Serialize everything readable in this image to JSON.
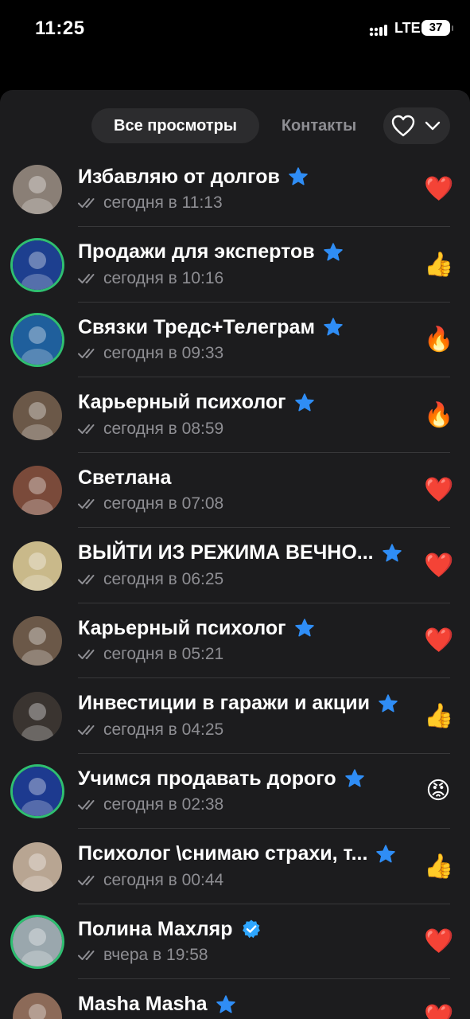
{
  "status": {
    "time": "11:25",
    "network": "LTE",
    "battery": "37"
  },
  "tabs": [
    {
      "label": "Все просмотры",
      "active": true
    },
    {
      "label": "Контакты",
      "active": false
    }
  ],
  "reaction_filter": {
    "icon": "heart-outline-icon",
    "chevron": "chevron-down-icon"
  },
  "viewers": [
    {
      "name": "Избавляю от долгов",
      "badge": "premium-star",
      "time": "сегодня в 11:13",
      "reaction": "❤️",
      "avatar_color": "#8a7f76"
    },
    {
      "name": "Продажи для экспертов",
      "badge": "premium-star",
      "time": "сегодня в 10:16",
      "reaction": "👍",
      "avatar_color": "#1d3f8f"
    },
    {
      "name": "Связки Тредс+Телеграм",
      "badge": "premium-star",
      "time": "сегодня в 09:33",
      "reaction": "🔥",
      "avatar_color": "#1f5f9c"
    },
    {
      "name": "Карьерный психолог",
      "badge": "premium-star",
      "time": "сегодня в 08:59",
      "reaction": "🔥",
      "avatar_color": "#6b5848"
    },
    {
      "name": "Светлана",
      "badge": "",
      "time": "сегодня в 07:08",
      "reaction": "❤️",
      "avatar_color": "#7a4a3a"
    },
    {
      "name": "ВЫЙТИ ИЗ РЕЖИМА ВЕЧНО...",
      "badge": "premium-star",
      "time": "сегодня в 06:25",
      "reaction": "❤️",
      "avatar_color": "#c9b98a"
    },
    {
      "name": "Карьерный психолог",
      "badge": "premium-star",
      "time": "сегодня в 05:21",
      "reaction": "❤️",
      "avatar_color": "#6b5848"
    },
    {
      "name": "Инвестиции в гаражи и акции",
      "badge": "premium-star",
      "time": "сегодня в 04:25",
      "reaction": "👍",
      "avatar_color": "#3a3430"
    },
    {
      "name": "Учимся продавать дорого",
      "badge": "premium-star",
      "time": "сегодня в 02:38",
      "reaction": "😡",
      "avatar_color": "#1d3a8f"
    },
    {
      "name": "Психолог \\снимаю страхи, т...",
      "badge": "premium-star",
      "time": "сегодня в 00:44",
      "reaction": "👍",
      "avatar_color": "#b8a592"
    },
    {
      "name": "Полина Махляр",
      "badge": "verified",
      "time": "вчера в 19:58",
      "reaction": "❤️",
      "avatar_color": "#9aa7ad"
    },
    {
      "name": "Masha Masha",
      "badge": "premium-star",
      "time": "",
      "reaction": "❤️",
      "avatar_color": "#8c6a58"
    }
  ],
  "colors": {
    "accent": "#2f8df5",
    "heart": "#ff3b30",
    "muted": "#8e8e93",
    "sheet": "#1c1c1e"
  }
}
